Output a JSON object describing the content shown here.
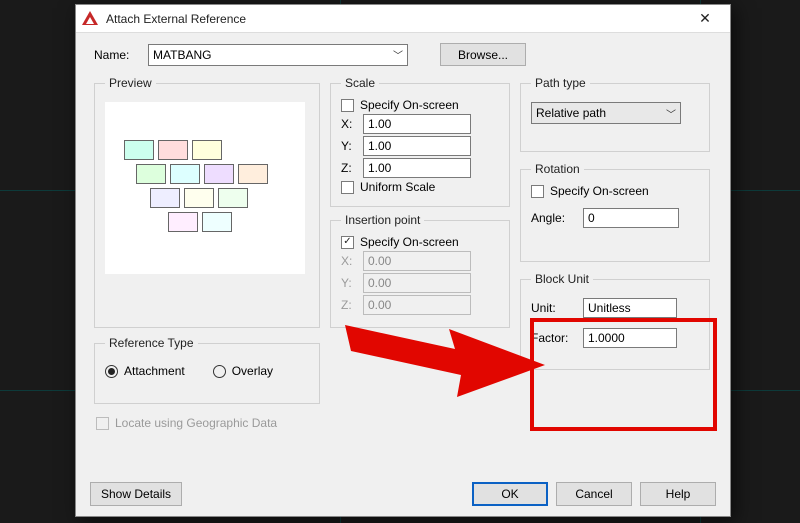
{
  "window": {
    "title": "Attach External Reference"
  },
  "name": {
    "label": "Name:",
    "value": "MATBANG",
    "browse": "Browse..."
  },
  "preview": {
    "legend": "Preview"
  },
  "scale": {
    "legend": "Scale",
    "specify": "Specify On-screen",
    "specify_checked": false,
    "x_label": "X:",
    "x": "1.00",
    "y_label": "Y:",
    "y": "1.00",
    "z_label": "Z:",
    "z": "1.00",
    "uniform_label": "Uniform Scale",
    "uniform_checked": false
  },
  "insertion": {
    "legend": "Insertion point",
    "specify": "Specify On-screen",
    "specify_checked": true,
    "x_label": "X:",
    "x": "0.00",
    "y_label": "Y:",
    "y": "0.00",
    "z_label": "Z:",
    "z": "0.00"
  },
  "pathtype": {
    "legend": "Path type",
    "value": "Relative path"
  },
  "rotation": {
    "legend": "Rotation",
    "specify": "Specify On-screen",
    "specify_checked": false,
    "angle_label": "Angle:",
    "angle": "0"
  },
  "blockunit": {
    "legend": "Block Unit",
    "unit_label": "Unit:",
    "unit": "Unitless",
    "factor_label": "Factor:",
    "factor": "1.0000"
  },
  "reftype": {
    "legend": "Reference Type",
    "attachment": "Attachment",
    "overlay": "Overlay",
    "selected": "attachment"
  },
  "locate": {
    "label": "Locate using Geographic Data",
    "checked": false,
    "enabled": false
  },
  "buttons": {
    "show_details": "Show Details",
    "ok": "OK",
    "cancel": "Cancel",
    "help": "Help"
  }
}
